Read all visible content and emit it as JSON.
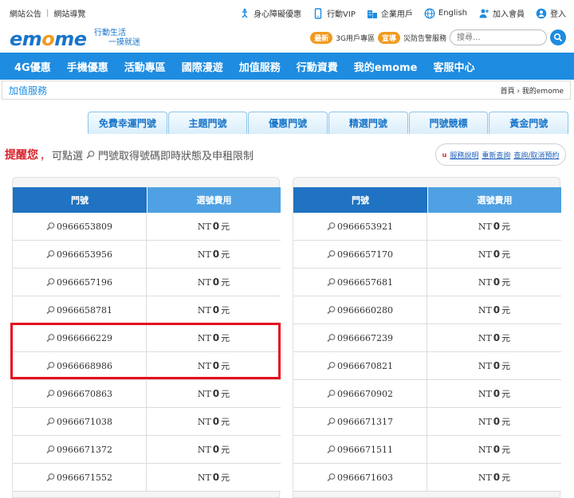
{
  "topbar": {
    "left_links": [
      "網站公告",
      "網站導覽"
    ],
    "right_links": [
      {
        "icon": "accessibility-icon",
        "label": "身心障礙優惠"
      },
      {
        "icon": "mobile-vip-icon",
        "label": "行動VIP"
      },
      {
        "icon": "building-icon",
        "label": "企業用戶"
      },
      {
        "icon": "globe-icon",
        "label": "English"
      },
      {
        "icon": "add-member-icon",
        "label": "加入會員"
      },
      {
        "icon": "user-icon",
        "label": "登入"
      }
    ]
  },
  "brand": {
    "logo_text": "emome",
    "slogan_line1": "行動生活",
    "slogan_line2": "一摸就迷"
  },
  "promo": {
    "badge1": "最新",
    "text1": "3G用戶專區",
    "badge2": "宣導",
    "text2": "災防告警服務"
  },
  "search": {
    "placeholder": "搜尋..."
  },
  "nav": [
    "4G優惠",
    "手機優惠",
    "活動專區",
    "國際漫遊",
    "加值服務",
    "行動資費",
    "我的emome",
    "客服中心"
  ],
  "section_title": "加值服務",
  "breadcrumb": "首頁 › 我的emome",
  "tabs": [
    "免費幸運門號",
    "主題門號",
    "優惠門號",
    "精選門號",
    "門號競標",
    "黃金門號"
  ],
  "reminder": {
    "alert": "提醒您",
    "comma": "，",
    "text": "可點選",
    "text2": "門號取得號碼即時狀態及申租限制"
  },
  "quick_links": [
    "服務說明",
    "重新查詢",
    "查詢/取消預約"
  ],
  "table": {
    "col_number": "門號",
    "col_fee": "選號費用",
    "fee_prefix": "NT",
    "fee_value": "0",
    "fee_unit": "元",
    "left_numbers": [
      "0966653809",
      "0966653956",
      "0966657196",
      "0966658781",
      "0966666229",
      "0966668986",
      "0966670863",
      "0966671038",
      "0966671372",
      "0966671552"
    ],
    "right_numbers": [
      "0966653921",
      "0966657170",
      "0966657681",
      "0966660280",
      "0966667239",
      "0966670821",
      "0966670902",
      "0966671317",
      "0966671511",
      "0966671603"
    ]
  },
  "colors": {
    "brand_blue": "#1e8ce0",
    "header_dark": "#1f73c2",
    "header_light": "#4fa1e3",
    "accent_orange": "#f29a1f",
    "highlight_red": "#e3101d"
  }
}
